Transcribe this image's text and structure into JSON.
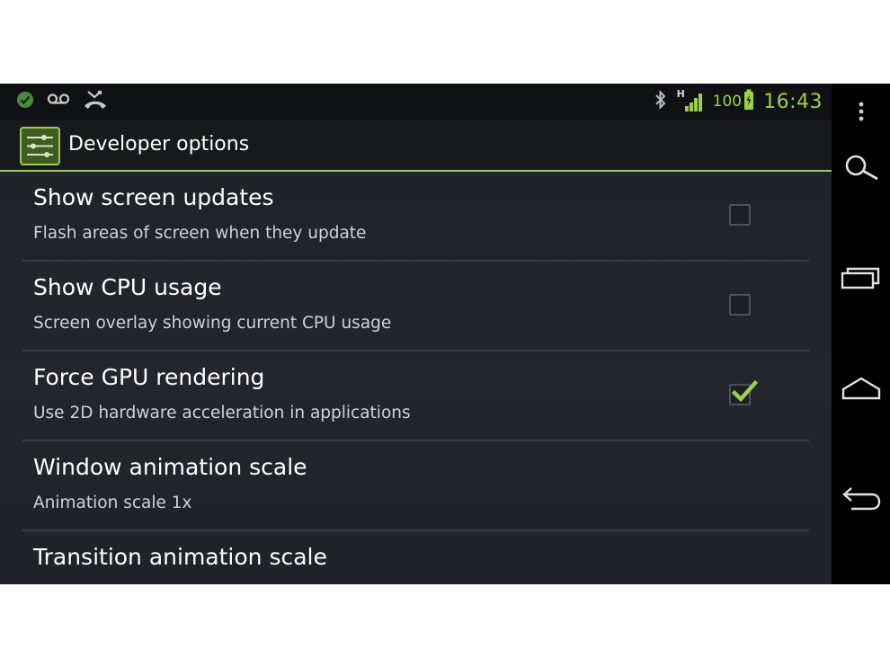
{
  "status_bar": {
    "battery_level": "100",
    "network_type": "H",
    "time": "16:43"
  },
  "action_bar": {
    "title": "Developer options"
  },
  "settings": [
    {
      "title": "Show screen updates",
      "summary": "Flash areas of screen when they update",
      "has_checkbox": true,
      "checked": false
    },
    {
      "title": "Show CPU usage",
      "summary": "Screen overlay showing current CPU usage",
      "has_checkbox": true,
      "checked": false
    },
    {
      "title": "Force GPU rendering",
      "summary": "Use 2D hardware acceleration in applications",
      "has_checkbox": true,
      "checked": true
    },
    {
      "title": "Window animation scale",
      "summary": "Animation scale 1x",
      "has_checkbox": false
    },
    {
      "title": "Transition animation scale",
      "summary": "",
      "has_checkbox": false
    }
  ],
  "colors": {
    "accent": "#9ec95a",
    "clock": "#9bd14a",
    "background": "#1f2227"
  },
  "icons": {
    "status_left": [
      "check-circle-icon",
      "voicemail-icon",
      "missed-call-icon"
    ],
    "status_right": [
      "bluetooth-icon",
      "signal-icon",
      "battery-icon"
    ],
    "nav": [
      "overflow-menu-icon",
      "search-icon",
      "recent-apps-icon",
      "home-icon",
      "back-icon"
    ]
  }
}
